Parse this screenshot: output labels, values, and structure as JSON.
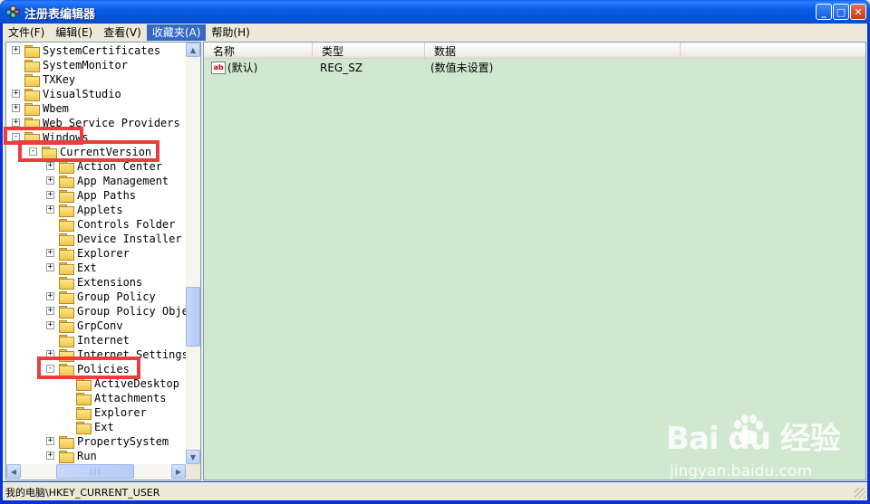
{
  "window": {
    "title": "注册表编辑器",
    "minimize": "_",
    "maximize": "□",
    "close": "✕"
  },
  "menu": [
    "文件(F)",
    "编辑(E)",
    "查看(V)",
    "收藏夹(A)",
    "帮助(H)"
  ],
  "menu_active_index": 3,
  "tree": [
    {
      "label": "SystemCertificates",
      "expander": "+",
      "depth": 0
    },
    {
      "label": "SystemMonitor",
      "expander": "",
      "depth": 0
    },
    {
      "label": "TXKey",
      "expander": "",
      "depth": 0
    },
    {
      "label": "VisualStudio",
      "expander": "+",
      "depth": 0
    },
    {
      "label": "Wbem",
      "expander": "+",
      "depth": 0
    },
    {
      "label": "Web Service Providers",
      "expander": "+",
      "depth": 0
    },
    {
      "label": "Windows",
      "expander": "-",
      "depth": 0
    },
    {
      "label": "CurrentVersion",
      "expander": "-",
      "depth": 1
    },
    {
      "label": "Action Center",
      "expander": "+",
      "depth": 2
    },
    {
      "label": "App Management",
      "expander": "+",
      "depth": 2
    },
    {
      "label": "App Paths",
      "expander": "+",
      "depth": 2
    },
    {
      "label": "Applets",
      "expander": "+",
      "depth": 2
    },
    {
      "label": "Controls Folder",
      "expander": "",
      "depth": 2
    },
    {
      "label": "Device Installer",
      "expander": "",
      "depth": 2
    },
    {
      "label": "Explorer",
      "expander": "+",
      "depth": 2
    },
    {
      "label": "Ext",
      "expander": "+",
      "depth": 2
    },
    {
      "label": "Extensions",
      "expander": "",
      "depth": 2
    },
    {
      "label": "Group Policy",
      "expander": "+",
      "depth": 2
    },
    {
      "label": "Group Policy Obje",
      "expander": "+",
      "depth": 2
    },
    {
      "label": "GrpConv",
      "expander": "+",
      "depth": 2
    },
    {
      "label": "Internet",
      "expander": "",
      "depth": 2
    },
    {
      "label": "Internet Settings",
      "expander": "+",
      "depth": 2
    },
    {
      "label": "Policies",
      "expander": "-",
      "depth": 2
    },
    {
      "label": "ActiveDesktop",
      "expander": "",
      "depth": 3
    },
    {
      "label": "Attachments",
      "expander": "",
      "depth": 3
    },
    {
      "label": "Explorer",
      "expander": "",
      "depth": 3
    },
    {
      "label": "Ext",
      "expander": "",
      "depth": 3
    },
    {
      "label": "PropertySystem",
      "expander": "+",
      "depth": 2
    },
    {
      "label": "Run",
      "expander": "+",
      "depth": 2
    }
  ],
  "list": {
    "columns": [
      "名称",
      "类型",
      "数据"
    ],
    "rows": [
      {
        "name": "(默认)",
        "type": "REG_SZ",
        "data": "(数值未设置)",
        "icon": "string-value-icon"
      }
    ]
  },
  "scroll": {
    "up": "▲",
    "down": "▼",
    "left": "◀",
    "right": "▶",
    "grip": "|||"
  },
  "status": {
    "path": "我的电脑\\HKEY_CURRENT_USER"
  },
  "watermark": {
    "brand": "Bai  du 经验",
    "url": "jingyan.baidu.com"
  },
  "colors": {
    "highlight": "#ee3b3b",
    "list_background": "#cfe8cf",
    "title_bar": "#0a59e6"
  }
}
